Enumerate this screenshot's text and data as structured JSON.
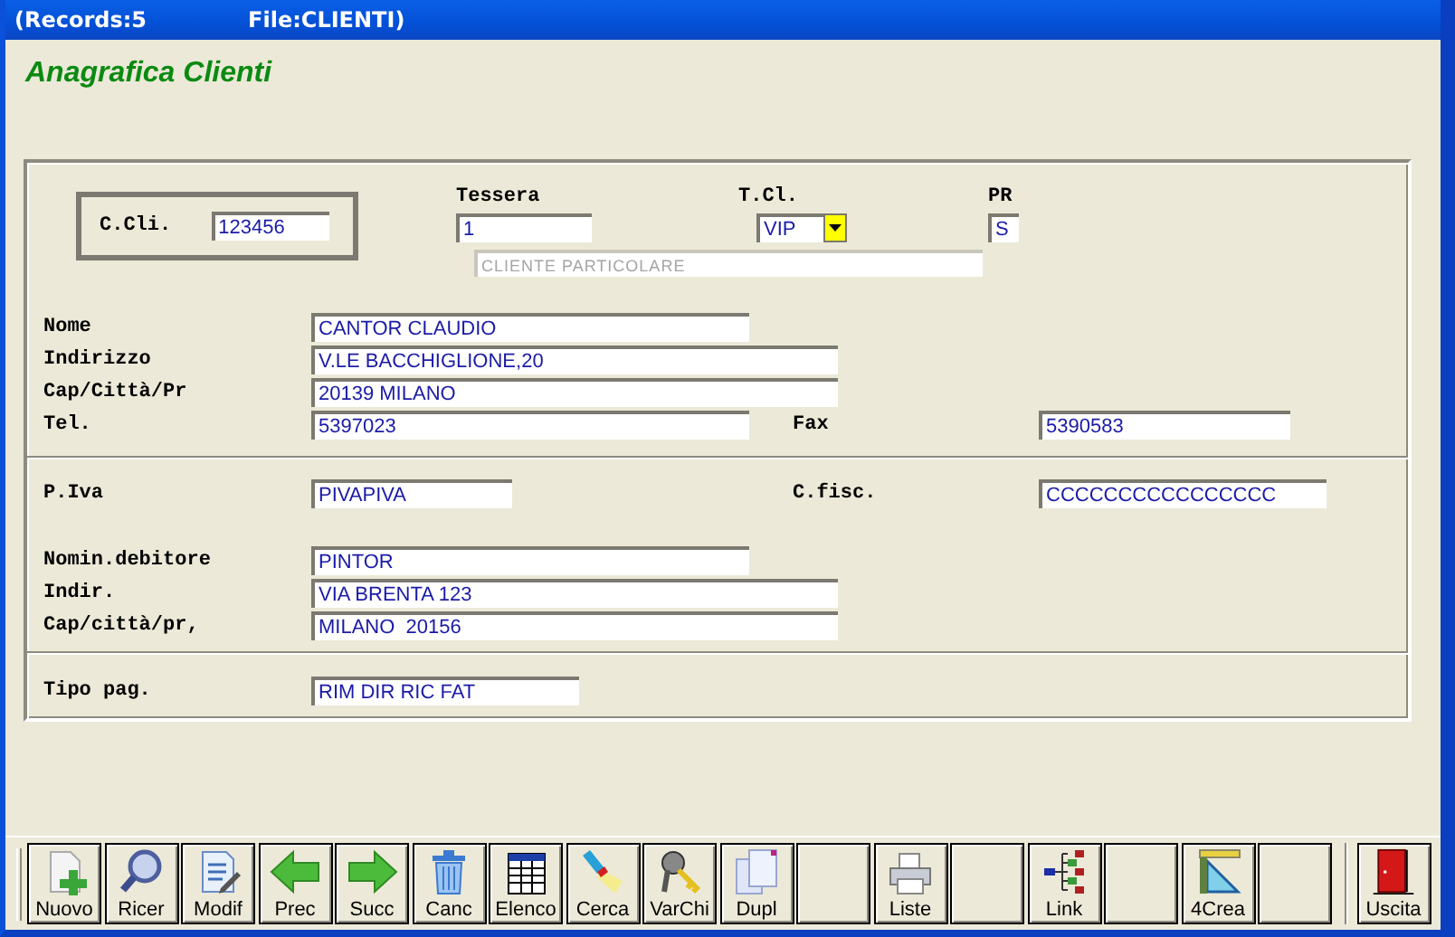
{
  "title_bar": {
    "records": "(Records:5",
    "file": "File:CLIENTI)"
  },
  "form_title": "Anagrafica Clienti",
  "header": {
    "code": {
      "label": "C.Cli.",
      "value": "123456"
    },
    "card": {
      "label": "Tessera",
      "value": "1"
    },
    "client_type": {
      "label": "T.Cl.",
      "value": "VIP"
    },
    "pr": {
      "label": "PR",
      "value": "S"
    },
    "type_description": {
      "value": "CLIENTE PARTICOLARE",
      "disabled": true
    }
  },
  "sections": [
    {
      "rows": [
        {
          "label": "Nome",
          "value": "CANTOR CLAUDIO"
        },
        {
          "label": "Indirizzo",
          "value": "V.LE BACCHIGLIONE,20"
        },
        {
          "label": "Cap/Città/Pr",
          "value": "20139 MILANO"
        },
        {
          "label": "Tel.",
          "value": "5397023",
          "side": {
            "label": "Fax",
            "value": "5390583"
          }
        }
      ]
    },
    {
      "rows": [
        {
          "label": "P.Iva",
          "value": "PIVAPIVA",
          "side": {
            "label": "C.fisc.",
            "value": "CCCCCCCCCCCCCCCC"
          }
        },
        {
          "label": "Nomin.debitore",
          "value": "PINTOR"
        },
        {
          "label": "Indir.",
          "value": "VIA BRENTA 123"
        },
        {
          "label": "Cap/città/pr,",
          "value": "MILANO  20156"
        }
      ]
    },
    {
      "rows": [
        {
          "label": "Tipo pag.",
          "value": "RIM DIR RIC FAT"
        }
      ]
    }
  ],
  "toolbar": [
    {
      "kind": "command",
      "label": "Nuovo"
    },
    {
      "kind": "command",
      "label": "Ricer"
    },
    {
      "kind": "command",
      "label": "Modif"
    },
    {
      "kind": "command",
      "label": "Prec"
    },
    {
      "kind": "command",
      "label": "Succ"
    },
    {
      "kind": "command",
      "label": "Canc"
    },
    {
      "kind": "command",
      "label": "Elenco"
    },
    {
      "kind": "command",
      "label": "Cerca"
    },
    {
      "kind": "command",
      "label": "VarChi"
    },
    {
      "kind": "command",
      "label": "Dupl"
    },
    {
      "kind": "blank"
    },
    {
      "kind": "command",
      "label": "Liste"
    },
    {
      "kind": "blank"
    },
    {
      "kind": "command",
      "label": "Link"
    },
    {
      "kind": "blank"
    },
    {
      "kind": "command",
      "label": "4Crea"
    },
    {
      "kind": "blank"
    },
    {
      "kind": "exit",
      "label": "Uscita"
    }
  ]
}
